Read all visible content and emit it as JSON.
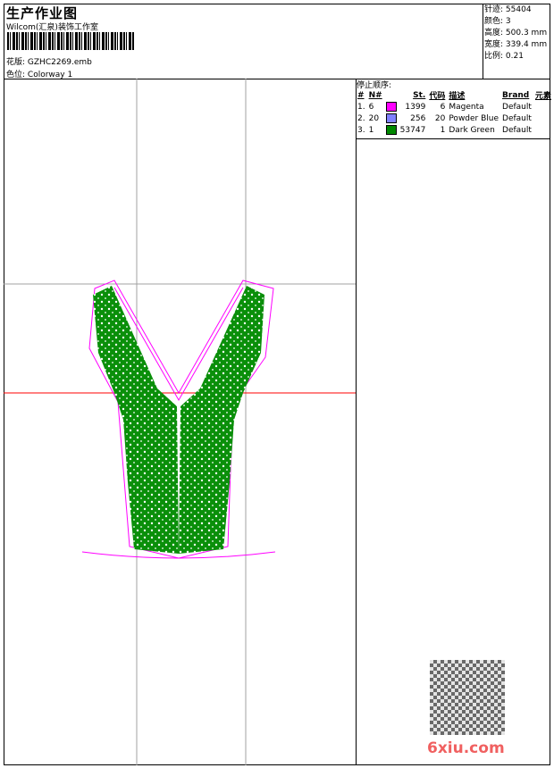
{
  "header": {
    "title": "生产作业图",
    "company": "Wilcom(汇泉)装饰工作室",
    "design_label": "花版:",
    "design_value": "GZHC2269.emb",
    "colorway_label": "色位:",
    "colorway_value": "Colorway 1"
  },
  "info": {
    "stitches_label": "针迹:",
    "stitches": "55404",
    "colors_label": "颜色:",
    "colors": "3",
    "height_label": "高度:",
    "height": "500.3 mm",
    "width_label": "宽度:",
    "width": "339.4 mm",
    "scale_label": "比例:",
    "scale": "0.21"
  },
  "stop_sequence": {
    "title": "停止顺序:",
    "columns": [
      "#",
      "N#",
      "St.",
      "代码",
      "描述",
      "Brand",
      "元素"
    ],
    "rows": [
      {
        "index": "1.",
        "n": "6",
        "color": "#ff00ff",
        "stitches": "1399",
        "code": "6",
        "desc": "Magenta",
        "brand": "Default"
      },
      {
        "index": "2.",
        "n": "20",
        "color": "#8080ff",
        "stitches": "256",
        "code": "20",
        "desc": "Powder Blue",
        "brand": "Default"
      },
      {
        "index": "3.",
        "n": "1",
        "color": "#008800",
        "stitches": "53747",
        "code": "1",
        "desc": "Dark Green",
        "brand": "Default"
      }
    ]
  },
  "watermark": "6xiu.com",
  "colors": {
    "embroidery": "#0a8f0a",
    "outline": "#ff00ff",
    "guide": "#a0a0a0",
    "center": "#ff0000"
  }
}
